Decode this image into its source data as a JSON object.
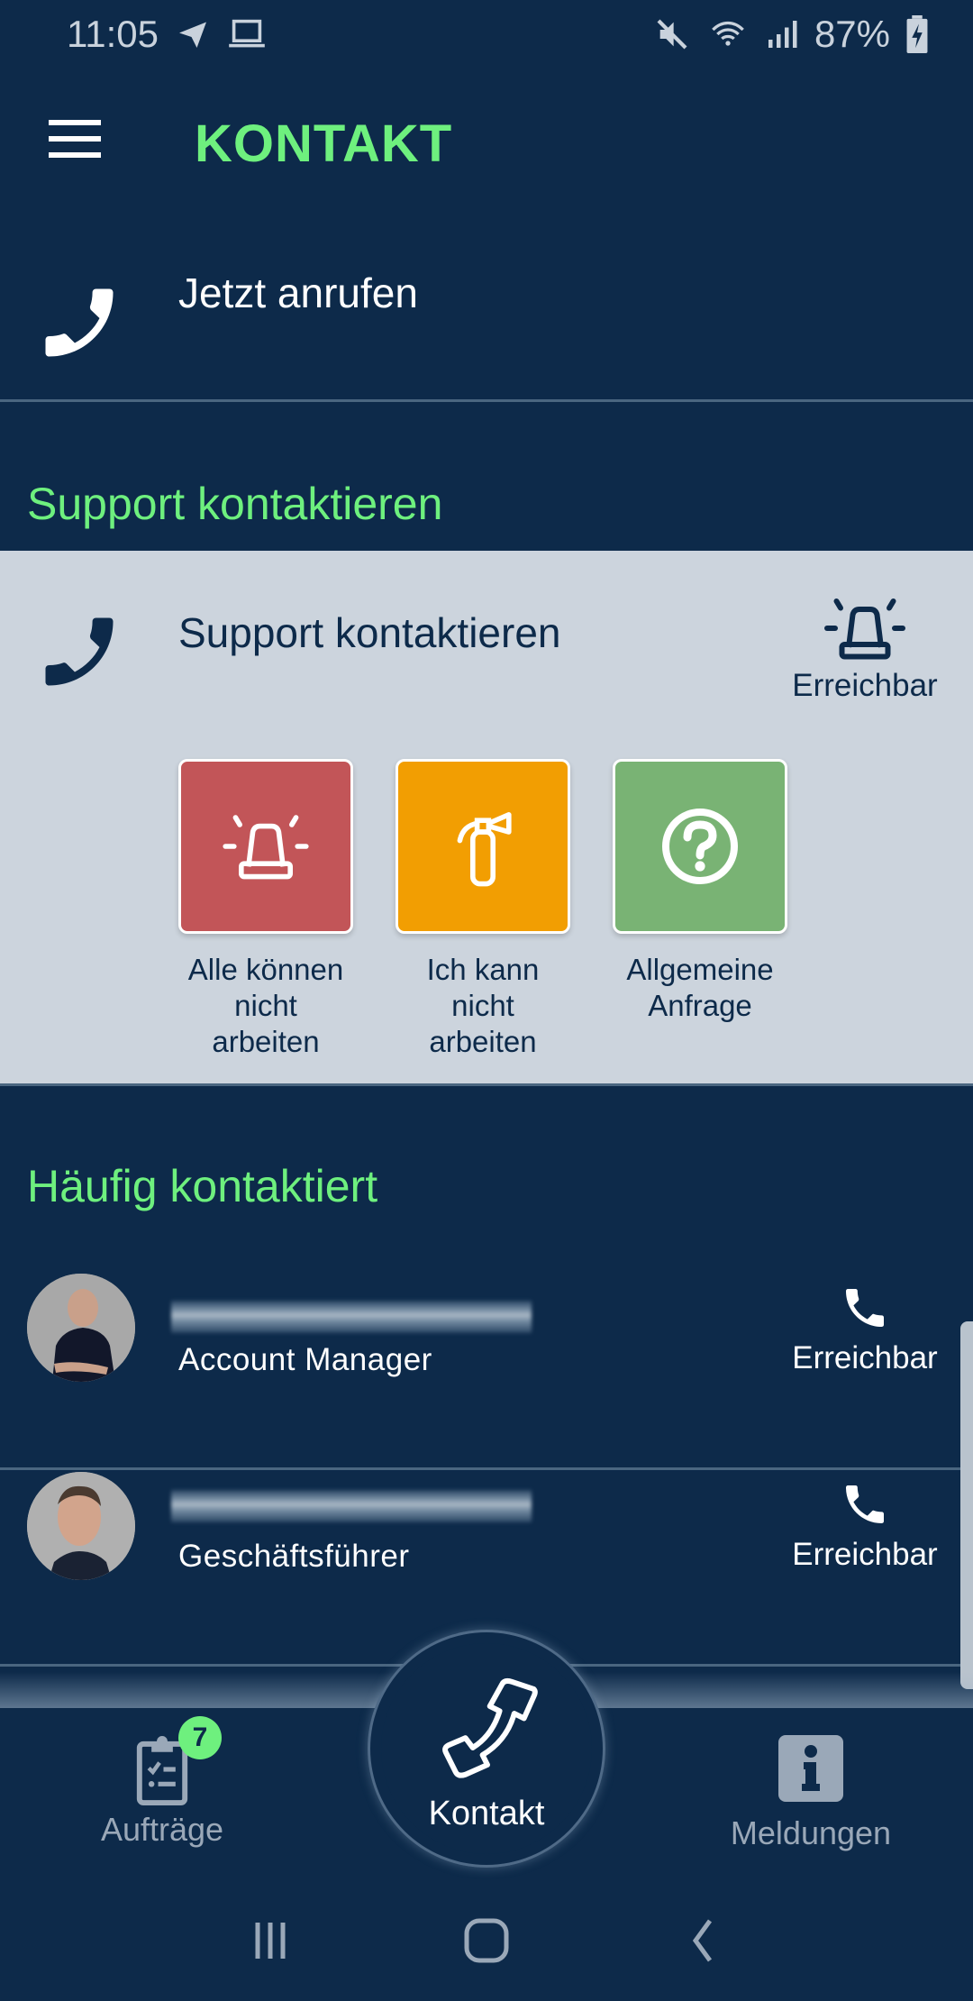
{
  "status_bar": {
    "time": "11:05",
    "battery": "87%",
    "icons": [
      "telegram-icon",
      "laptop-icon",
      "mute-icon",
      "wifi-icon",
      "signal-icon",
      "battery-charging-icon"
    ]
  },
  "app_bar": {
    "title": "KONTAKT",
    "menu_icon": "hamburger-menu-icon"
  },
  "call_now": {
    "label": "Jetzt anrufen",
    "icon": "phone-icon"
  },
  "support_section": {
    "title": "Support kontaktieren",
    "header_label": "Support kontaktieren",
    "status": "Erreichbar",
    "status_icon": "siren-icon",
    "tiles": [
      {
        "label": "Alle können nicht arbeiten",
        "icon": "siren-icon",
        "color": "#c25558"
      },
      {
        "label": "Ich kann nicht arbeiten",
        "icon": "fire-extinguisher-icon",
        "color": "#f29e02"
      },
      {
        "label": "Allgemeine Anfrage",
        "icon": "question-circle-icon",
        "color": "#79b374"
      }
    ]
  },
  "frequent_section": {
    "title": "Häufig kontaktiert",
    "contacts": [
      {
        "name": "",
        "role": "Account Manager",
        "status": "Erreichbar"
      },
      {
        "name": "",
        "role": "Geschäftsführer",
        "status": "Erreichbar"
      }
    ]
  },
  "tab_bar": {
    "tabs": [
      {
        "label": "Aufträge",
        "icon": "clipboard-checklist-icon",
        "badge": "7"
      },
      {
        "label": "Kontakt",
        "icon": "phone-icon",
        "active": true
      },
      {
        "label": "Meldungen",
        "icon": "info-icon"
      }
    ]
  },
  "colors": {
    "background": "#0d2a4a",
    "accent": "#6ef07e",
    "panel": "#ccd4dd"
  }
}
